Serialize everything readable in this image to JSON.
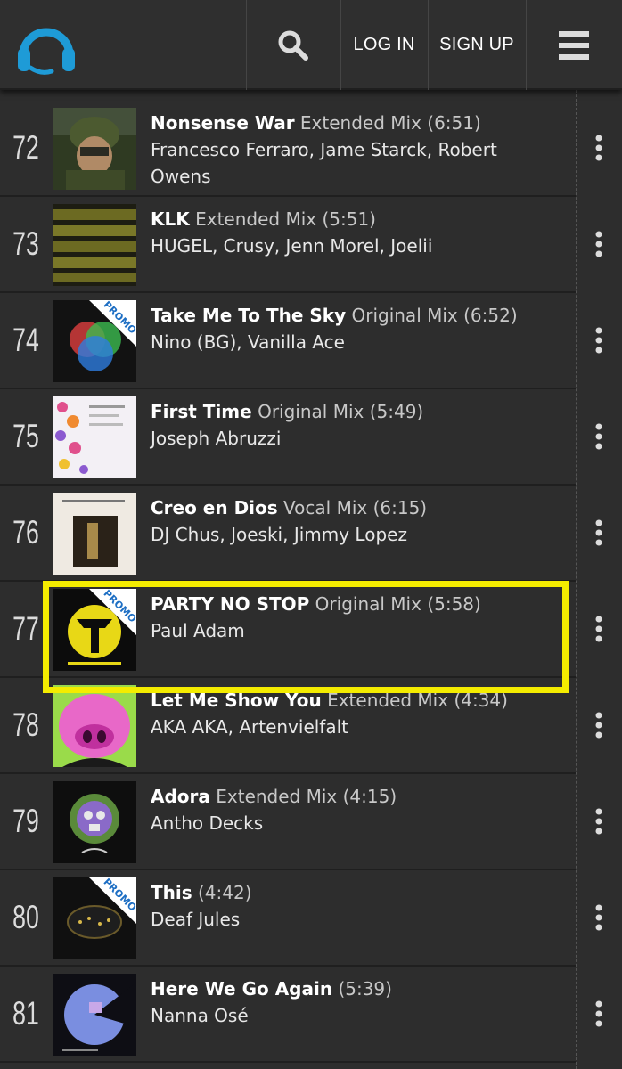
{
  "header": {
    "logo_icon": "headphones-icon",
    "search_icon": "search-icon",
    "login_label": "LOG IN",
    "signup_label": "SIGN UP",
    "menu_icon": "hamburger-menu-icon",
    "accent_color": "#1e9bd7",
    "highlight_color": "#f4ec00"
  },
  "tracks": [
    {
      "rank": "72",
      "title": "Nonsense War",
      "mix": "Extended Mix",
      "duration": "(6:51)",
      "artists": "Francesco Ferraro, Jame Starck, Robert Owens",
      "promo": false
    },
    {
      "rank": "73",
      "title": "KLK",
      "mix": "Extended Mix",
      "duration": "(5:51)",
      "artists": "HUGEL, Crusy, Jenn Morel, Joelii",
      "promo": false
    },
    {
      "rank": "74",
      "title": "Take Me To The Sky",
      "mix": "Original Mix",
      "duration": "(6:52)",
      "artists": "Nino (BG), Vanilla Ace",
      "promo": true,
      "promo_label": "PROMO"
    },
    {
      "rank": "75",
      "title": "First Time",
      "mix": "Original Mix",
      "duration": "(5:49)",
      "artists": "Joseph Abruzzi",
      "promo": false
    },
    {
      "rank": "76",
      "title": "Creo en Dios",
      "mix": "Vocal Mix",
      "duration": "(6:15)",
      "artists": "DJ Chus, Joeski, Jimmy Lopez",
      "promo": false
    },
    {
      "rank": "77",
      "title": "PARTY NO STOP",
      "mix": "Original Mix",
      "duration": "(5:58)",
      "artists": "Paul Adam",
      "promo": true,
      "promo_label": "PROMO",
      "highlighted": true
    },
    {
      "rank": "78",
      "title": "Let Me Show You",
      "mix": "Extended Mix",
      "duration": "(4:34)",
      "artists": "AKA AKA, Artenvielfalt",
      "promo": false
    },
    {
      "rank": "79",
      "title": "Adora",
      "mix": "Extended Mix",
      "duration": "(4:15)",
      "artists": "Antho Decks",
      "promo": false
    },
    {
      "rank": "80",
      "title": "This",
      "mix": "",
      "duration": "(4:42)",
      "artists": "Deaf Jules",
      "promo": true,
      "promo_label": "PROMO"
    },
    {
      "rank": "81",
      "title": "Here We Go Again",
      "mix": "",
      "duration": "(5:39)",
      "artists": "Nanna Osé",
      "promo": false
    }
  ],
  "row_more_icon": "vertical-dots-icon"
}
